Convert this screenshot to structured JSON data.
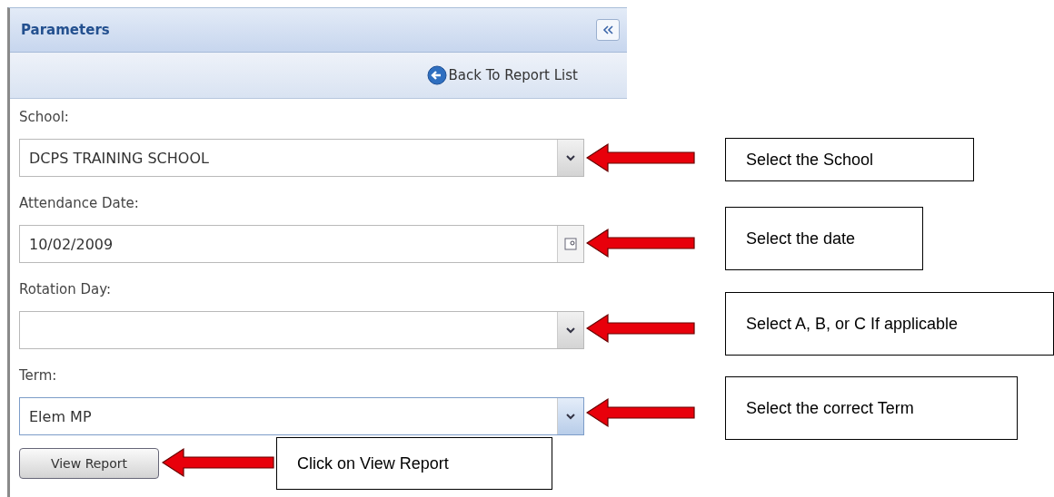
{
  "panel": {
    "title": "Parameters",
    "back_link": "Back To Report List"
  },
  "fields": [
    {
      "label": "School:",
      "kind": "select",
      "value": "DCPS TRAINING SCHOOL",
      "focused": false
    },
    {
      "label": "Attendance Date:",
      "kind": "date",
      "value": "10/02/2009",
      "focused": false
    },
    {
      "label": "Rotation Day:",
      "kind": "select",
      "focused": false
    },
    {
      "label": "Term:",
      "kind": "select",
      "value": "Elem MP",
      "focused": true
    }
  ],
  "button": "View Report",
  "annotations": [
    {
      "text": "Select the School"
    },
    {
      "text": "Select the date"
    },
    {
      "text": "Select A, B, or C If applicable"
    },
    {
      "text": "Select the correct Term"
    },
    {
      "text": "Click on View Report"
    }
  ]
}
